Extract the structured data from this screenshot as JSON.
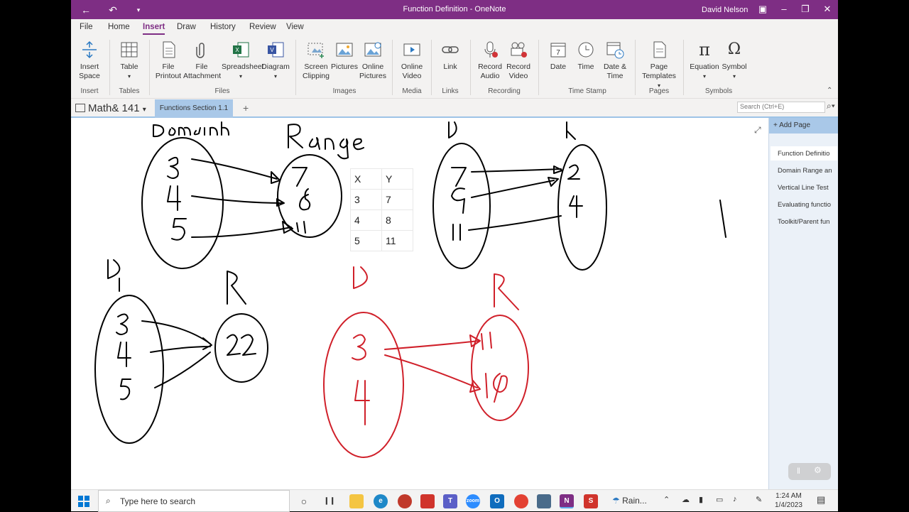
{
  "window": {
    "title": "Function Definition - OneNote",
    "user": "David Nelson",
    "back_icon": "back-arrow-icon",
    "undo_icon": "undo-icon"
  },
  "menu": {
    "tabs": [
      "File",
      "Home",
      "Insert",
      "Draw",
      "History",
      "Review",
      "View"
    ],
    "active": "Insert"
  },
  "ribbon": {
    "buttons": {
      "insert_space": "Insert Space",
      "table": "Table",
      "file_printout": "File Printout",
      "file_attachment": "File Attachment",
      "spreadsheet": "Spreadsheet",
      "diagram": "Diagram",
      "screen_clipping": "Screen Clipping",
      "pictures": "Pictures",
      "online_pictures": "Online Pictures",
      "online_video": "Online Video",
      "link": "Link",
      "record_audio": "Record Audio",
      "record_video": "Record Video",
      "date": "Date",
      "time": "Time",
      "date_time": "Date & Time",
      "page_templates": "Page Templates",
      "equation": "Equation",
      "symbol": "Symbol"
    },
    "groups": {
      "insert": "Insert",
      "tables": "Tables",
      "files": "Files",
      "images": "Images",
      "media": "Media",
      "links": "Links",
      "recording": "Recording",
      "time_stamp": "Time Stamp",
      "pages": "Pages",
      "symbols": "Symbols"
    }
  },
  "notebook": {
    "name": "Math& 141",
    "section_tab": "Functions Section 1.1",
    "search_placeholder": "Search (Ctrl+E)"
  },
  "pages": {
    "add_label": "Add Page",
    "items": [
      "Function Definitio",
      "Domain Range an",
      "Vertical Line Test",
      "Evaluating functio",
      "Toolkit/Parent fun"
    ],
    "selected_index": 0
  },
  "table": {
    "headers": [
      "X",
      "Y"
    ],
    "rows": [
      [
        "3",
        "7"
      ],
      [
        "4",
        "8"
      ],
      [
        "5",
        "11"
      ]
    ]
  },
  "taskbar": {
    "search_placeholder": "Type here to search",
    "weather": "Rain...",
    "time": "1:24 AM",
    "date": "1/4/2023"
  },
  "colors": {
    "brand": "#7e2e84",
    "ink": "#000000",
    "red_ink": "#d0202a",
    "section": "#a9c8e8"
  }
}
